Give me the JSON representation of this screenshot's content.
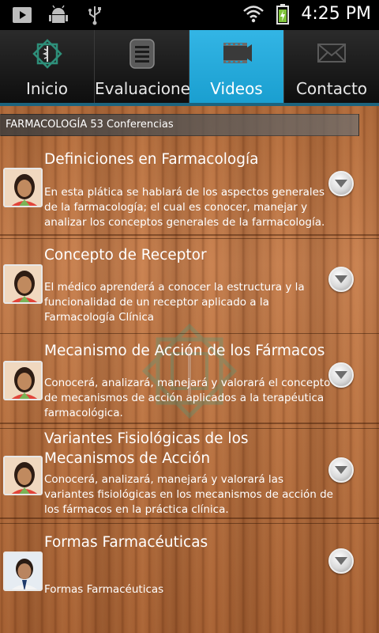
{
  "status_bar": {
    "time": "4:25 PM",
    "icons": [
      "youtube-icon",
      "android-debug-icon",
      "usb-icon",
      "wifi-icon",
      "battery-charging-icon"
    ]
  },
  "tabs": [
    {
      "label": "Inicio",
      "icon": "logo-icon",
      "selected": false
    },
    {
      "label": "Evaluaciones",
      "icon": "list-icon",
      "selected": false
    },
    {
      "label": "Videos",
      "icon": "film-icon",
      "selected": true
    },
    {
      "label": "Contacto",
      "icon": "mail-icon",
      "selected": false
    }
  ],
  "section": {
    "header": "FARMACOLOGÍA 53 Conferencias"
  },
  "items": [
    {
      "title": "Definiciones en Farmacología",
      "description": "En esta plática se hablará de los aspectos generales de la farmacología; el cual es conocer, manejar y analizar los conceptos generales  de la farmacología."
    },
    {
      "title": "Concepto de Receptor",
      "description": "El médico aprenderá a conocer la estructura y la funcionalidad de un receptor aplicado a la Farmacología Clínica"
    },
    {
      "title": "Mecanismo de Acción de los Fármacos",
      "description": "Conocerá, analizará, manejará y valorará el concepto de mecanismos de acción aplicados a la terapéutica farmacológica."
    },
    {
      "title": "Variantes Fisiológicas de los Mecanismos de Acción",
      "description": "Conocerá, analizará, manejará y valorará las variantes fisiológicas en los mecanismos de acción de los fármacos en la práctica clínica."
    },
    {
      "title": "Formas Farmacéuticas",
      "description": "Formas Farmacéuticas"
    }
  ],
  "colors": {
    "accent": "#33b5e5",
    "wood": "#c07a47"
  }
}
